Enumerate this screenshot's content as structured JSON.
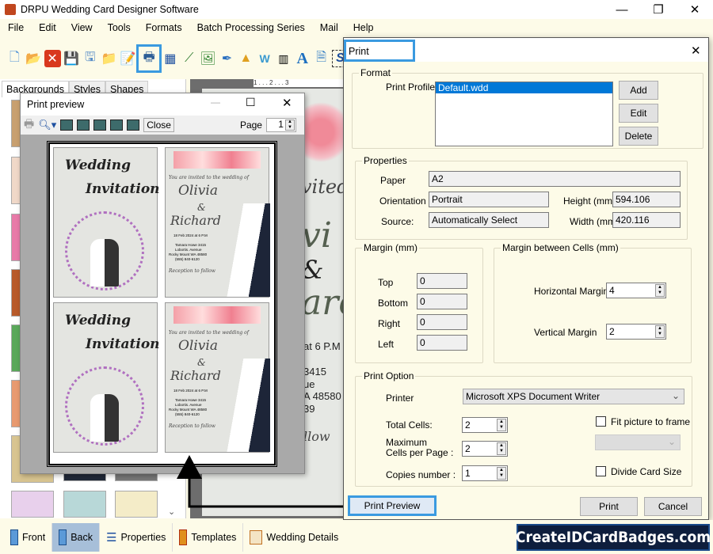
{
  "app": {
    "title": "DRPU Wedding Card Designer Software"
  },
  "menu": [
    "File",
    "Edit",
    "View",
    "Tools",
    "Formats",
    "Batch Processing Series",
    "Mail",
    "Help"
  ],
  "left_tabs": [
    "Backgrounds",
    "Styles",
    "Shapes"
  ],
  "canvas_text": {
    "l1": "vited",
    "l2": "vi",
    "l3": "&",
    "l4": "are",
    "l5": "at 6 P.M",
    "l6": "3415",
    "l7": "ue",
    "l8": "A 48580",
    "l9": "39",
    "l10": "llow",
    "ruler": "1 . . . 2 . . . 3"
  },
  "preview": {
    "title": "Print preview",
    "close_label": "Close",
    "page_label": "Page",
    "page_value": "1",
    "card_front": {
      "line1": "Wedding",
      "line2": "Invitation"
    },
    "card_back": {
      "invite": "You are invited to the wedding of",
      "bride": "Olivia",
      "amp": "&",
      "groom": "Richard",
      "date": "18 Feb 2024 at 6 P.M",
      "addr1": "Tamara Howe 3415",
      "addr2": "Lobortis. Avenue",
      "addr3": "Rocky Mount WA 48580",
      "addr4": "(555) 840-6120",
      "reception": "Reception to follow"
    }
  },
  "dialog": {
    "title": "Print",
    "format": {
      "legend": "Format",
      "profile_label": "Print Profile",
      "profiles": [
        "Default.wdd"
      ],
      "add": "Add",
      "edit": "Edit",
      "delete": "Delete"
    },
    "properties": {
      "legend": "Properties",
      "paper_label": "Paper",
      "paper": "A2",
      "orientation_label": "Orientation",
      "orientation": "Portrait",
      "source_label": "Source:",
      "source": "Automatically Select",
      "height_label": "Height (mm)",
      "height": "594.106",
      "width_label": "Width (mm)",
      "width": "420.116"
    },
    "margin": {
      "legend": "Margin (mm)",
      "top_label": "Top",
      "top": "0",
      "bottom_label": "Bottom",
      "bottom": "0",
      "right_label": "Right",
      "right": "0",
      "left_label": "Left",
      "left": "0"
    },
    "cell_margin": {
      "legend": "Margin between Cells (mm)",
      "h_label": "Horizontal Margin",
      "h": "4",
      "v_label": "Vertical Margin",
      "v": "2"
    },
    "print_option": {
      "legend": "Print Option",
      "printer_label": "Printer",
      "printer": "Microsoft XPS Document Writer",
      "total_label": "Total Cells:",
      "total": "2",
      "max_label1": "Maximum",
      "max_label2": "Cells per Page :",
      "max": "2",
      "copies_label": "Copies number :",
      "copies": "1",
      "fit_label": "Fit picture to frame",
      "fit_checked": false,
      "divide_label": "Divide Card Size",
      "divide_checked": false
    },
    "print_preview": "Print Preview",
    "print": "Print",
    "cancel": "Cancel"
  },
  "bottom": {
    "items": [
      "Front",
      "Back",
      "Properties",
      "Templates",
      "Wedding Details"
    ],
    "active": "Back"
  },
  "brand": "CreateIDCardBadges.com"
}
